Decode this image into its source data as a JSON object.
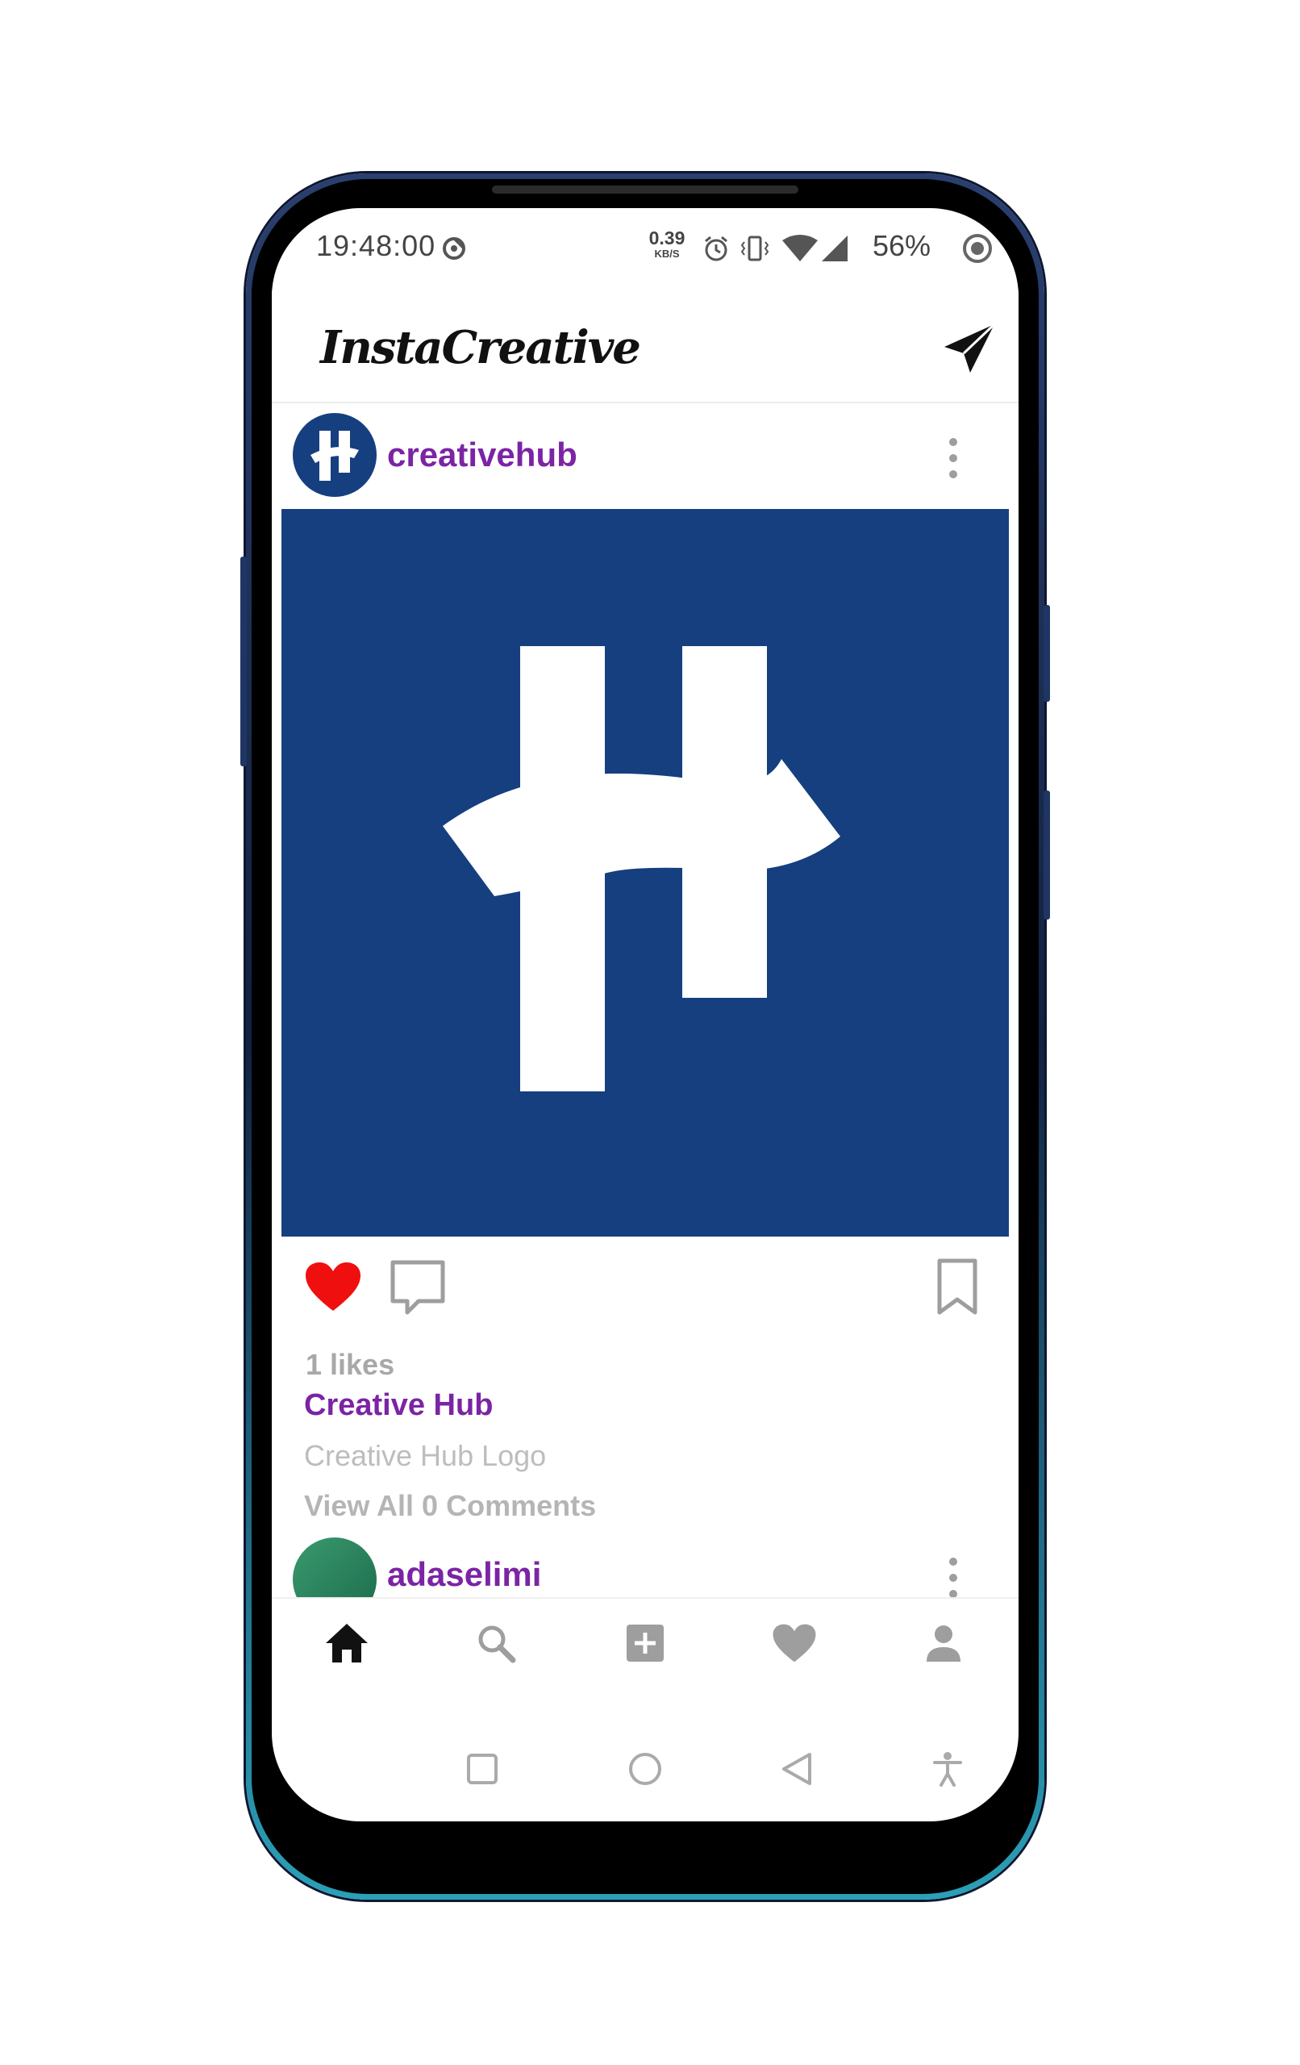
{
  "status_bar": {
    "time": "19:48:00",
    "net_speed_value": "0.39",
    "net_speed_unit": "KB/S",
    "battery": "56%"
  },
  "app": {
    "title": "InstaCreative"
  },
  "post": {
    "username": "creativehub",
    "image_alt": "Creative Hub logo",
    "likes": "1 likes",
    "author_name": "Creative Hub",
    "caption": "Creative Hub Logo",
    "view_comments": "View All 0 Comments",
    "liked": true
  },
  "next_post": {
    "username": "adaselimi"
  },
  "bottom_nav": {
    "items": [
      "home-icon",
      "search-icon",
      "add-post-icon",
      "activity-heart-icon",
      "profile-icon"
    ],
    "active": "home-icon"
  },
  "system_nav": {
    "items": [
      "recents-icon",
      "home-circle-icon",
      "back-icon",
      "accessibility-icon"
    ]
  },
  "colors": {
    "brand_purple": "#7b24a4",
    "logo_blue": "#163f80",
    "like_red": "#f00f0f",
    "icon_gray": "#9e9e9e"
  }
}
